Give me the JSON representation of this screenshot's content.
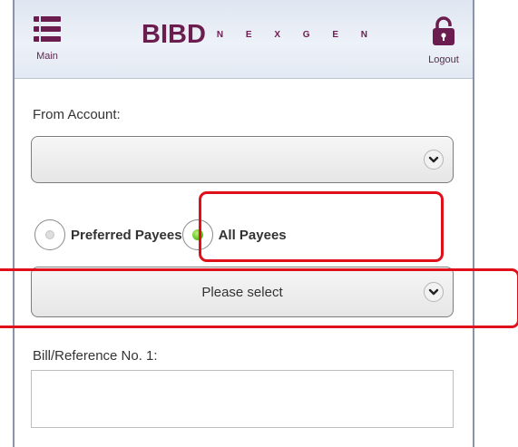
{
  "header": {
    "brand": "BIBD",
    "brand_suffix": "N E X G E N",
    "main_label": "Main",
    "logout_label": "Logout",
    "brand_color": "#6b1d4f"
  },
  "form": {
    "from_account_label": "From Account:",
    "from_account_value": "",
    "payee_options": [
      {
        "label": "Preferred Payees",
        "selected": false
      },
      {
        "label": "All Payees",
        "selected": true
      }
    ],
    "payee_select_value": "Please select",
    "bill_ref_label": "Bill/Reference No. 1:",
    "bill_ref_value": ""
  },
  "annotation": {
    "highlight_color": "#e0101a"
  }
}
